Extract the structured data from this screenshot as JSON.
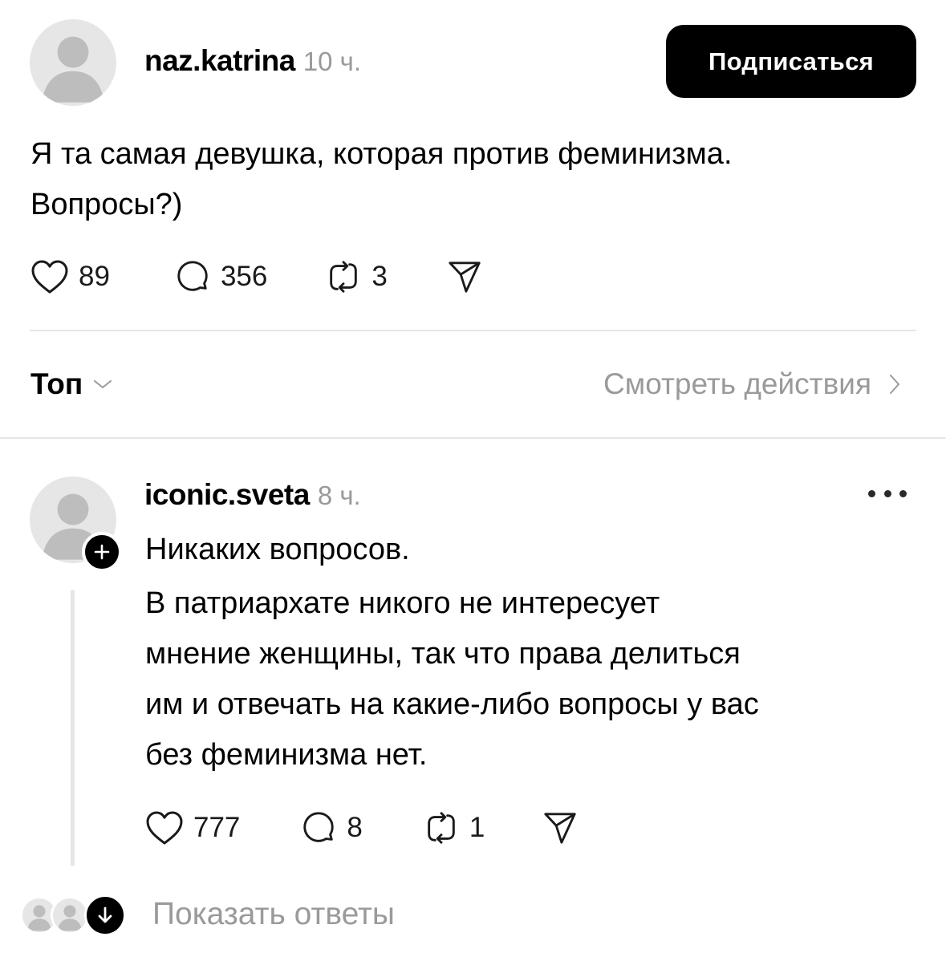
{
  "post": {
    "author": "naz.katrina",
    "time": "10 ч.",
    "avatar_note": "Фото профиля (заглушка)",
    "follow_label": "Подписаться",
    "text_line1": "Я  та самая девушка, которая против феминизма.",
    "text_line2": "Вопросы?)",
    "likes": "89",
    "comments": "356",
    "reposts": "3"
  },
  "sort": {
    "label": "Топ",
    "activity_label": "Смотреть действия"
  },
  "reply": {
    "author": "iconic.sveta",
    "time": "8 ч.",
    "avatar_note": "Фото профиля (заглушка)",
    "line1": "Никаких вопросов.",
    "line2": "В патриархате никого не интересует",
    "line3": "мнение женщины, так что права делиться",
    "line4": "им и отвечать на какие-либо вопросы у вас",
    "line5": "без феминизма нет.",
    "likes": "777",
    "comments": "8",
    "reposts": "1"
  },
  "footer": {
    "show_replies": "Показать ответы"
  },
  "icons": [
    "heart-icon",
    "comment-icon",
    "repost-icon",
    "share-icon",
    "chevron-down-icon",
    "chevron-right-icon",
    "more-icon",
    "plus-icon",
    "arrow-down-icon"
  ],
  "colors": {
    "accent": "#000000",
    "muted": "#9a9a9a",
    "divider": "#e6e6e6"
  }
}
